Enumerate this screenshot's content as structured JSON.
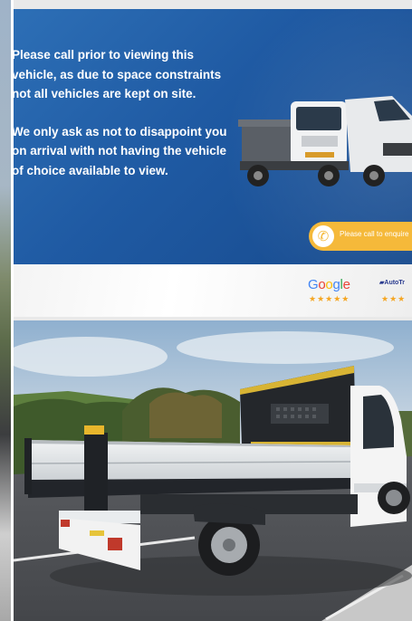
{
  "banner": {
    "notice_paragraphs": [
      "Please call prior to viewing this vehicle, as due to space constraints not all vehicles are kept on site.",
      "We only ask as not to disappoint you on arrival with not having the vehicle of choice available to view."
    ],
    "call_button_label": "Please call to enquire",
    "reviews": [
      {
        "name": "Google",
        "stars": "★★★★★"
      },
      {
        "name": "AutoTrader",
        "stars": "★★★"
      }
    ]
  },
  "colors": {
    "banner_blue": "#1f5aa3",
    "call_button": "#f5b93a",
    "tipper_body": "#dfe3e6",
    "cab_white": "#f4f4f4"
  },
  "photo": {
    "subject": "tipper-truck"
  }
}
